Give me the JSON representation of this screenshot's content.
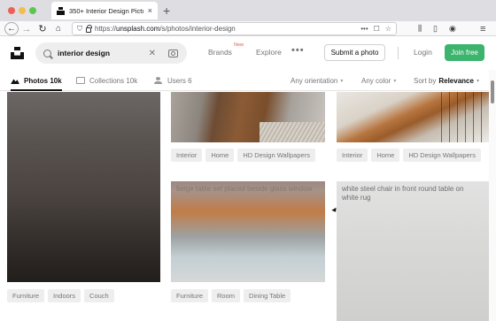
{
  "browser": {
    "tab_title": "350+ Interior Design Pictures [",
    "tab_close": "×",
    "new_tab": "+",
    "url_prefix": "https://",
    "url_domain": "unsplash.com",
    "url_path": "/s/photos/interior-design",
    "url_actions": [
      "•••",
      "☐",
      "☆"
    ]
  },
  "header": {
    "search_value": "interior design",
    "brands": "Brands",
    "brands_badge": "New",
    "explore": "Explore",
    "more": "•••",
    "submit": "Submit a photo",
    "login": "Login",
    "join": "Join free"
  },
  "filters": {
    "tabs": [
      {
        "label": "Photos 10k",
        "active": true,
        "icon": "photo-icon"
      },
      {
        "label": "Collections 10k",
        "active": false,
        "icon": "collection-icon"
      },
      {
        "label": "Users 6",
        "active": false,
        "icon": "users-icon"
      }
    ],
    "orientation": "Any orientation",
    "color": "Any color",
    "sort_prefix": "Sort by",
    "sort_value": "Relevance"
  },
  "gallery": {
    "alt_img4": "beige table set placed beside glass window",
    "alt_img5": "white steel chair in front round table on white rug",
    "tags_row1_col2": [
      "Interior",
      "Home",
      "HD Design Wallpapers"
    ],
    "tags_row1_col3": [
      "Interior",
      "Home",
      "HD Design Wallpapers"
    ],
    "tags_row2_col1": [
      "Furniture",
      "Indoors",
      "Couch"
    ],
    "tags_row2_col2": [
      "Furniture",
      "Room",
      "Dining Table"
    ]
  }
}
